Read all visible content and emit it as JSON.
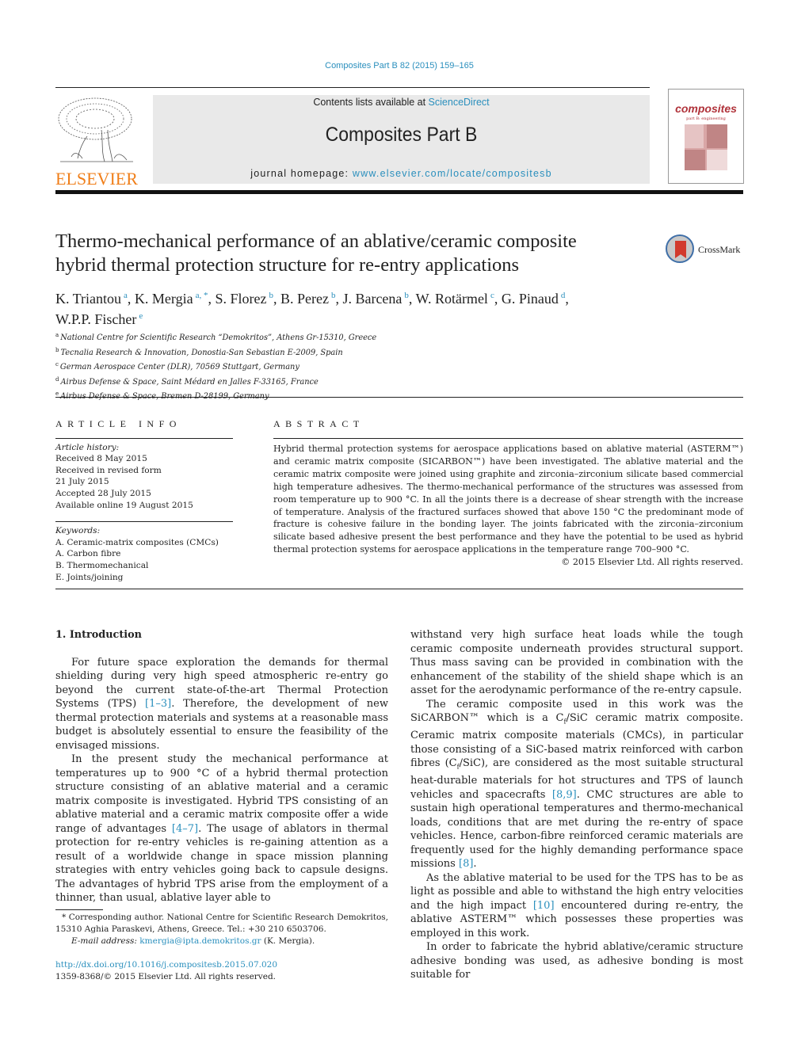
{
  "header": {
    "journal_ref": "Composites Part B 82 (2015) 159–165",
    "contents_prefix": "Contents lists available at ",
    "contents_link": "ScienceDirect",
    "journal_title": "Composites Part B",
    "homepage_prefix": "journal homepage: ",
    "homepage_link": "www.elsevier.com/locate/compositesb",
    "publisher_logo_text": "ELSEVIER",
    "cover_word": "composites",
    "cover_subtitle": "part B: engineering"
  },
  "colors": {
    "link": "#2a8fbd",
    "elsevier_orange": "#f07f1a",
    "banner_bg": "#e9e9e9",
    "crossmark_red": "#d23a2d"
  },
  "article": {
    "title_line1": "Thermo-mechanical performance of an ablative/ceramic composite",
    "title_line2": "hybrid thermal protection structure for re-entry applications",
    "crossmark_label": "CrossMark",
    "authors": [
      {
        "name": "K. Triantou",
        "sup": "a",
        "sep": ", "
      },
      {
        "name": "K. Mergia",
        "sup": "a, *",
        "sep": ", "
      },
      {
        "name": "S. Florez",
        "sup": "b",
        "sep": ", "
      },
      {
        "name": "B. Perez",
        "sup": "b",
        "sep": ", "
      },
      {
        "name": "J. Barcena",
        "sup": "b",
        "sep": ", "
      },
      {
        "name": "W. Rotärmel",
        "sup": "c",
        "sep": ", "
      },
      {
        "name": "G. Pinaud",
        "sup": "d",
        "sep": ","
      },
      {
        "name": "W.P.P. Fischer",
        "sup": "e",
        "sep": ""
      }
    ],
    "affiliations": [
      {
        "key": "a",
        "text": "National Centre for Scientific Research “Demokritos”, Athens Gr-15310, Greece"
      },
      {
        "key": "b",
        "text": "Tecnalia Research & Innovation, Donostia-San Sebastian E-2009, Spain"
      },
      {
        "key": "c",
        "text": "German Aerospace Center (DLR), 70569 Stuttgart, Germany"
      },
      {
        "key": "d",
        "text": "Airbus Defense & Space, Saint Médard en Jalles F-33165, France"
      },
      {
        "key": "e",
        "text": "Airbus Defense & Space, Bremen D-28199, Germany"
      }
    ]
  },
  "article_info": {
    "heading": "ARTICLE INFO",
    "history_label": "Article history:",
    "history": [
      "Received 8 May 2015",
      "Received in revised form",
      "21 July 2015",
      "Accepted 28 July 2015",
      "Available online 19 August 2015"
    ],
    "keywords_label": "Keywords:",
    "keywords": [
      "A. Ceramic-matrix composites (CMCs)",
      "A. Carbon fibre",
      "B. Thermomechanical",
      "E. Joints/joining"
    ]
  },
  "abstract": {
    "heading": "ABSTRACT",
    "text": "Hybrid thermal protection systems for aerospace applications based on ablative material (ASTERM™) and ceramic matrix composite (SICARBON™) have been investigated. The ablative material and the ceramic matrix composite were joined using graphite and zirconia–zirconium silicate based commercial high temperature adhesives. The thermo-mechanical performance of the structures was assessed from room temperature up to 900 °C. In all the joints there is a decrease of shear strength with the increase of temperature. Analysis of the fractured surfaces showed that above 150 °C the predominant mode of fracture is cohesive failure in the bonding layer. The joints fabricated with the zirconia–zirconium silicate based adhesive present the best performance and they have the potential to be used as hybrid thermal protection systems for aerospace applications in the temperature range 700–900 °C.",
    "copyright": "© 2015 Elsevier Ltd. All rights reserved."
  },
  "body": {
    "section_heading": "1.  Introduction",
    "left_p1": {
      "pre": "For future space exploration the demands for thermal shielding during very high speed atmospheric re-entry go beyond the current state-of-the-art Thermal Protection Systems (TPS) ",
      "cite": "[1–3]",
      "post": ". Therefore, the development of new thermal protection materials and systems at a reasonable mass budget is absolutely essential to ensure the feasibility of the envisaged missions."
    },
    "left_p2": {
      "pre": "In the present study the mechanical performance at temperatures up to 900 °C of a hybrid thermal protection structure consisting of an ablative material and a ceramic matrix composite is investigated. Hybrid TPS consisting of an ablative material and a ceramic matrix composite offer a wide range of advantages ",
      "cite": "[4–7]",
      "post": ". The usage of ablators in thermal protection for re-entry vehicles is re-gaining attention as a result of a worldwide change in space mission planning strategies with entry vehicles going back to capsule designs. The advantages of hybrid TPS arise from the employment of a thinner, than usual, ablative layer able to"
    },
    "right_p1": "withstand very high surface heat loads while the tough ceramic composite underneath provides structural support. Thus mass saving can be provided in combination with the enhancement of the stability of the shield shape which is an asset for the aerodynamic performance of the re-entry capsule.",
    "right_p2": {
      "pre": "The ceramic composite used in this work was the SiCARBON™ which is a C",
      "sub1": "f",
      "mid1": "/SiC ceramic matrix composite. Ceramic matrix composite materials (CMCs), in particular those consisting of a SiC-based matrix reinforced with carbon fibres (C",
      "sub2": "f",
      "mid2": "/SiC), are considered as the most suitable structural heat-durable materials for hot structures and TPS of launch vehicles and spacecrafts ",
      "cite1": "[8,9]",
      "mid3": ". CMC structures are able to sustain high operational temperatures and thermo-mechanical loads, conditions that are met during the re-entry of space vehicles. Hence, carbon-fibre reinforced ceramic materials are frequently used for the highly demanding performance space missions ",
      "cite2": "[8]",
      "post": "."
    },
    "right_p3": {
      "pre": "As the ablative material to be used for the TPS has to be as light as possible and able to withstand the high entry velocities and the high impact ",
      "cite": "[10]",
      "post": " encountered during re-entry, the ablative ASTERM™ which possesses these properties was employed in this work."
    },
    "right_p4": "In order to fabricate the hybrid ablative/ceramic structure adhesive bonding was used, as adhesive bonding is most suitable for"
  },
  "footnote": {
    "corresponding": "* Corresponding author. National Centre for Scientific Research Demokritos, 15310 Aghia Paraskevi, Athens, Greece. Tel.: +30 210 6503706.",
    "email_label": "E-mail address: ",
    "email": "kmergia@ipta.demokritos.gr",
    "email_suffix": " (K. Mergia).",
    "doi": "http://dx.doi.org/10.1016/j.compositesb.2015.07.020",
    "issn_line": "1359-8368/© 2015 Elsevier Ltd. All rights reserved."
  }
}
